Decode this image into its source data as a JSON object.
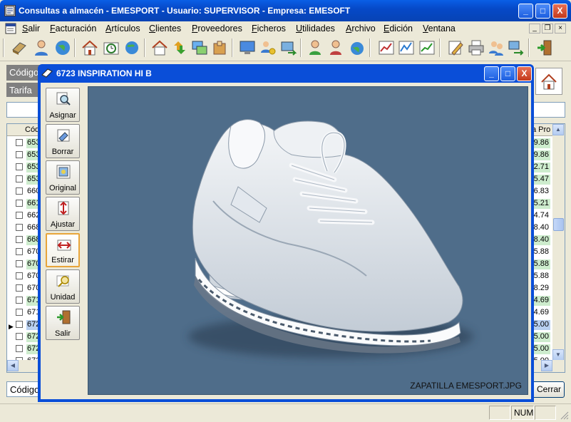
{
  "app": {
    "title": "Consultas a almacén - EMESPORT  -  Usuario: SUPERVISOR  -  Empresa: EMESOFT",
    "caption_min": "_",
    "caption_max": "□",
    "caption_close": "X"
  },
  "menu": {
    "items": [
      "Salir",
      "Facturación",
      "Artículos",
      "Clientes",
      "Proveedores",
      "Ficheros",
      "Utilidades",
      "Archivo",
      "Edición",
      "Ventana"
    ],
    "mdi_min": "_",
    "mdi_restore": "❐",
    "mdi_close": "×"
  },
  "toolbar": {
    "icons": [
      "notebook-icon",
      "user-icon",
      "globe-icon",
      "house-icon",
      "clock-icon",
      "globe-arrow-icon",
      "house-icon",
      "arrows-icon",
      "computer-icon",
      "box-icon",
      "monitor-icon",
      "users-coins-icon",
      "computer-arrows-icon",
      "user-arrow-icon",
      "user-mail-icon",
      "globe-user-icon",
      "chart-icon",
      "chart-icon",
      "chart-icon",
      "edit-icon",
      "printer-icon",
      "users-transfer-icon",
      "computer-transfer-icon",
      "exit-door-icon"
    ]
  },
  "form": {
    "codigo_label": "Código",
    "tarifa_label": "Tarifa",
    "list_header_code": "Códi",
    "list_header_price": "a Pro",
    "bottom_codigo_label": "Código",
    "close_button": "Cerrar"
  },
  "list": {
    "rows": [
      {
        "code": "653",
        "price": "9.86",
        "style": "green"
      },
      {
        "code": "653",
        "price": "9.86",
        "style": "green"
      },
      {
        "code": "653",
        "price": "2.71",
        "style": "green"
      },
      {
        "code": "653",
        "price": "5.47",
        "style": "green"
      },
      {
        "code": "660",
        "price": "6.83",
        "style": "white"
      },
      {
        "code": "661",
        "price": "5.21",
        "style": "green"
      },
      {
        "code": "662",
        "price": "4.74",
        "style": "white"
      },
      {
        "code": "668",
        "price": "8.40",
        "style": "white"
      },
      {
        "code": "668",
        "price": "8.40",
        "style": "green"
      },
      {
        "code": "670",
        "price": "5.88",
        "style": "white"
      },
      {
        "code": "670",
        "price": "5.88",
        "style": "green"
      },
      {
        "code": "670",
        "price": "5.88",
        "style": "white"
      },
      {
        "code": "670",
        "price": "8.29",
        "style": "white"
      },
      {
        "code": "671",
        "price": "4.69",
        "style": "green"
      },
      {
        "code": "671",
        "price": "4.69",
        "style": "white"
      },
      {
        "code": "672",
        "price": "5.00",
        "style": "sel"
      },
      {
        "code": "672",
        "price": "5.00",
        "style": "green"
      },
      {
        "code": "672",
        "price": "5.00",
        "style": "green"
      },
      {
        "code": "672",
        "price": "5.00",
        "style": "white"
      }
    ]
  },
  "status": {
    "num": "NUM"
  },
  "image_window": {
    "title": "6723 INSPIRATION HI B",
    "buttons": [
      {
        "label": "Asignar",
        "icon": "magnifier-icon"
      },
      {
        "label": "Borrar",
        "icon": "eraser-icon"
      },
      {
        "label": "Original",
        "icon": "picture-icon"
      },
      {
        "label": "Ajustar",
        "icon": "fit-vertical-icon"
      },
      {
        "label": "Estirar",
        "icon": "stretch-horizontal-icon"
      },
      {
        "label": "Unidad",
        "icon": "drive-search-icon"
      },
      {
        "label": "Salir",
        "icon": "exit-door-icon"
      }
    ],
    "active_button": "Estirar",
    "image_caption": "ZAPATILLA EMESPORT.JPG"
  },
  "colors": {
    "titlebar_blue": "#0649c8",
    "image_background": "#4f6d8a",
    "row_green": "#cdeccd",
    "row_selected": "#b7cff0"
  }
}
